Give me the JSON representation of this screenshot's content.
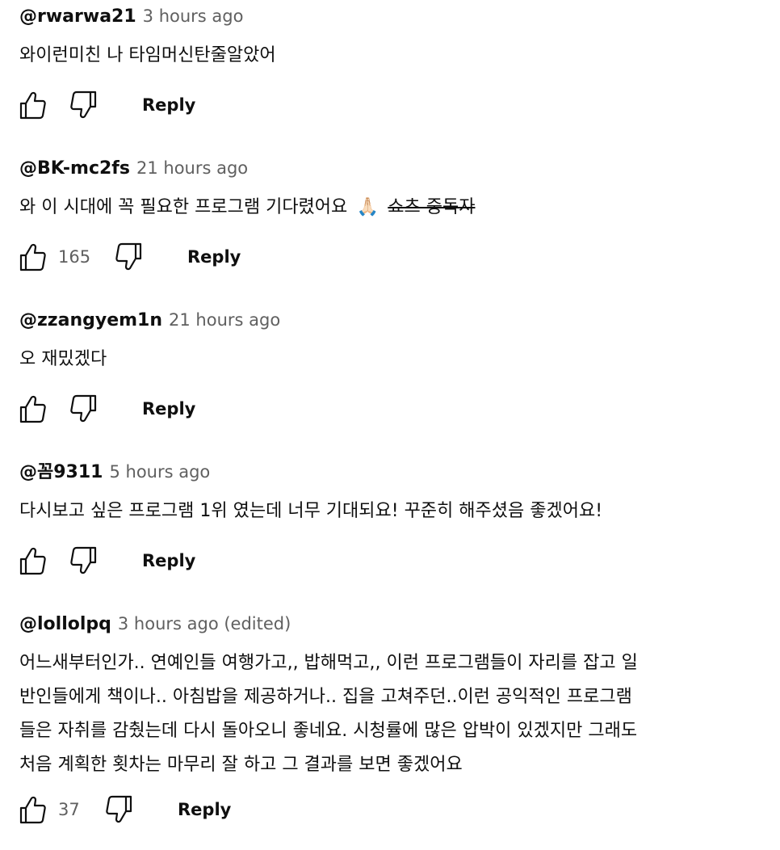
{
  "comments": [
    {
      "author": "@rwarwa21",
      "time": "3 hours ago",
      "text": "와이런미친 나 타임머신탄줄알았어",
      "likes": "",
      "reply_label": "Reply"
    },
    {
      "author": "@BK-mc2fs",
      "time": "21 hours ago",
      "text": "와 이 시대에 꼭 필요한 프로그램 기다렸어요",
      "emoji": "🙏🏻",
      "strike_text": "쇼츠 중독자",
      "likes": "165",
      "reply_label": "Reply"
    },
    {
      "author": "@zzangyem1n",
      "time": "21 hours ago",
      "text": "오 재밌겠다",
      "likes": "",
      "reply_label": "Reply"
    },
    {
      "author": "@꼼9311",
      "time": "5 hours ago",
      "text": "다시보고 싶은 프로그램 1위 였는데 너무 기대되요! 꾸준히 해주셨음 좋겠어요!",
      "likes": "",
      "reply_label": "Reply"
    },
    {
      "author": "@lollolpq",
      "time": "3 hours ago (edited)",
      "text_lines": [
        "어느새부터인가.. 연예인들 여행가고,, 밥해먹고,, 이런 프로그램들이 자리를 잡고 일",
        "반인들에게 책이나.. 아침밥을 제공하거나.. 집을 고쳐주던..이런 공익적인 프로그램",
        "들은 자취를 감췄는데 다시 돌아오니 좋네요. 시청률에 많은 압박이 있겠지만 그래도",
        "처음 계획한 횟차는 마무리 잘 하고 그 결과를 보면 좋겠어요"
      ],
      "likes": "37",
      "reply_label": "Reply"
    }
  ],
  "icons": {
    "like": "thumbs-up-icon",
    "dislike": "thumbs-down-icon"
  },
  "colors": {
    "text": "#0f0f0f",
    "secondary": "#606060",
    "background": "#ffffff"
  }
}
